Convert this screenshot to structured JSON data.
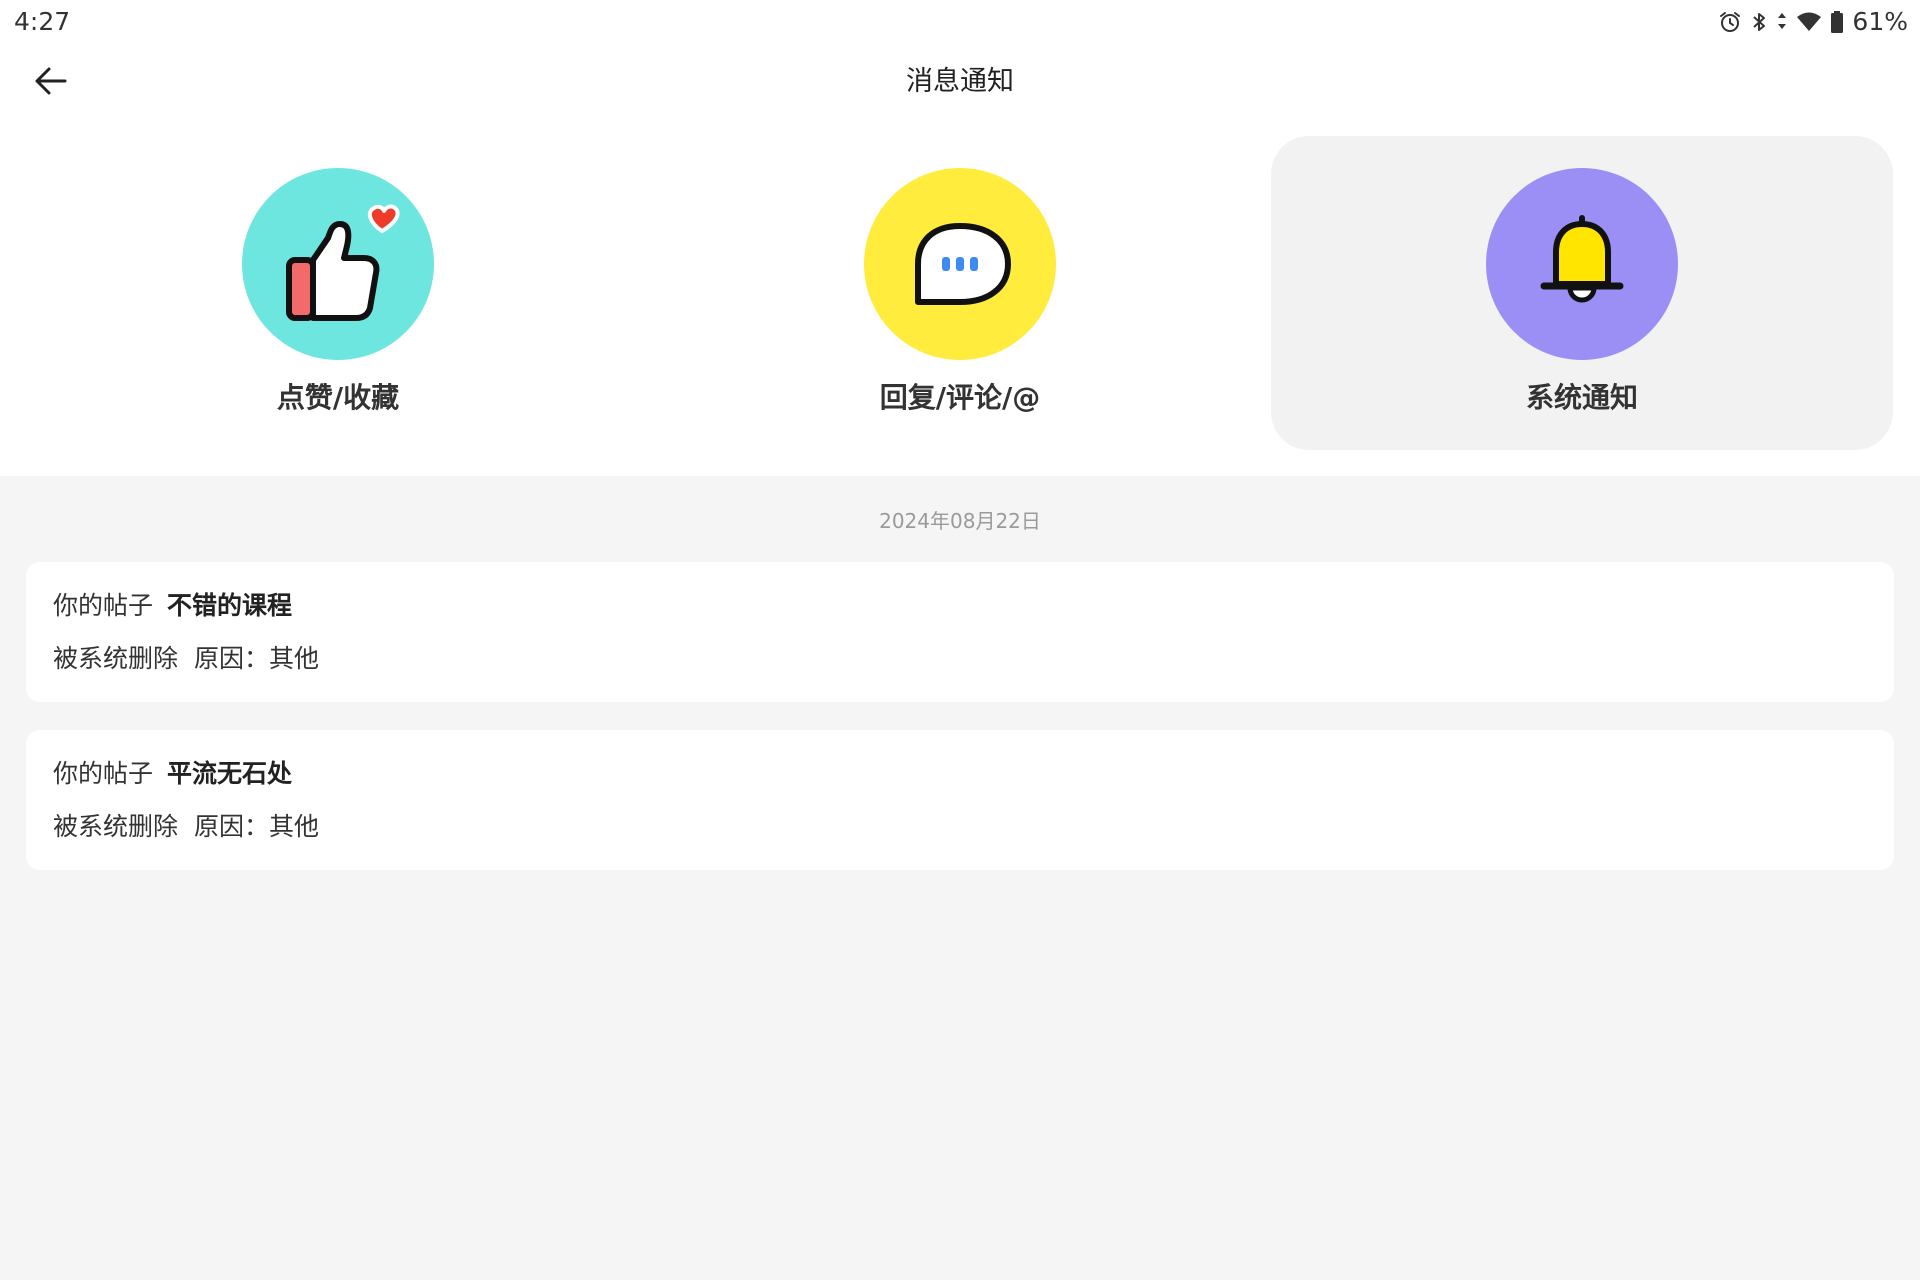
{
  "status_bar": {
    "time": "4:27",
    "battery": "61%",
    "icons": [
      "alarm-icon",
      "bluetooth-icon",
      "data-arrows-icon",
      "wifi-icon",
      "battery-icon"
    ]
  },
  "header": {
    "title": "消息通知",
    "back_icon": "arrow-left-icon"
  },
  "categories": [
    {
      "label": "点赞/收藏",
      "icon": "thumbs-up-heart-icon",
      "color": "#6ee6e0",
      "selected": false
    },
    {
      "label": "回复/评论/@",
      "icon": "chat-bubble-icon",
      "color": "#ffec3d",
      "selected": false
    },
    {
      "label": "系统通知",
      "icon": "bell-icon",
      "color": "#9b8ff5",
      "selected": true
    }
  ],
  "notices": {
    "date": "2024年08月22日",
    "items": [
      {
        "prefix": "你的帖子",
        "post_title": "不错的课程",
        "action": "被系统删除",
        "reason": "原因：其他"
      },
      {
        "prefix": "你的帖子",
        "post_title": "平流无石处",
        "action": "被系统删除",
        "reason": "原因：其他"
      }
    ]
  },
  "colors": {
    "background": "#f4f5f4",
    "header_background": "#ffffff",
    "selected_tab": "#f2f2f2"
  }
}
